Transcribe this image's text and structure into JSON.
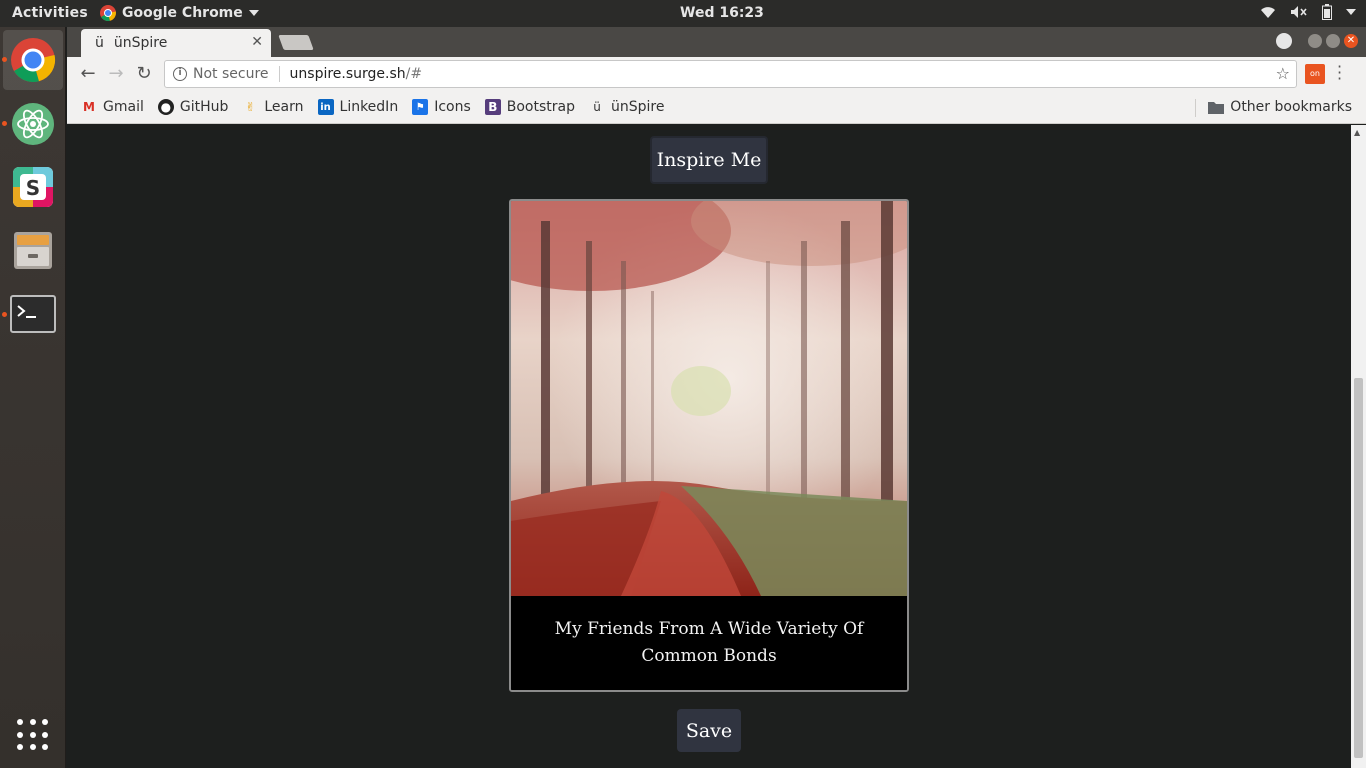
{
  "topbar": {
    "activities": "Activities",
    "app_name": "Google Chrome",
    "clock": "Wed 16:23"
  },
  "dock": {
    "apps": [
      "Google Chrome",
      "Atom",
      "Slack",
      "Files",
      "Terminal"
    ]
  },
  "tab": {
    "favicon": "ü",
    "title": "ünSpire"
  },
  "omnibox": {
    "security": "Not secure",
    "host": "unspire.surge.sh",
    "path": "/#"
  },
  "bookmarks": {
    "items": [
      {
        "label": "Gmail",
        "icon": "gmail-icon"
      },
      {
        "label": "GitHub",
        "icon": "github-icon"
      },
      {
        "label": "Learn",
        "icon": "learn-icon"
      },
      {
        "label": "LinkedIn",
        "icon": "linkedin-icon"
      },
      {
        "label": "Icons",
        "icon": "icons-flag-icon"
      },
      {
        "label": "Bootstrap",
        "icon": "bootstrap-icon"
      },
      {
        "label": "ünSpire",
        "icon": "unspire-icon"
      }
    ],
    "other": "Other bookmarks"
  },
  "page": {
    "inspire_button": "Inspire Me",
    "quote": "My Friends From A Wide Variety Of Common Bonds",
    "save_button": "Save"
  },
  "colors": {
    "page_bg": "#1d1f1e",
    "button_bg": "#303440",
    "accent": "#e95420"
  }
}
